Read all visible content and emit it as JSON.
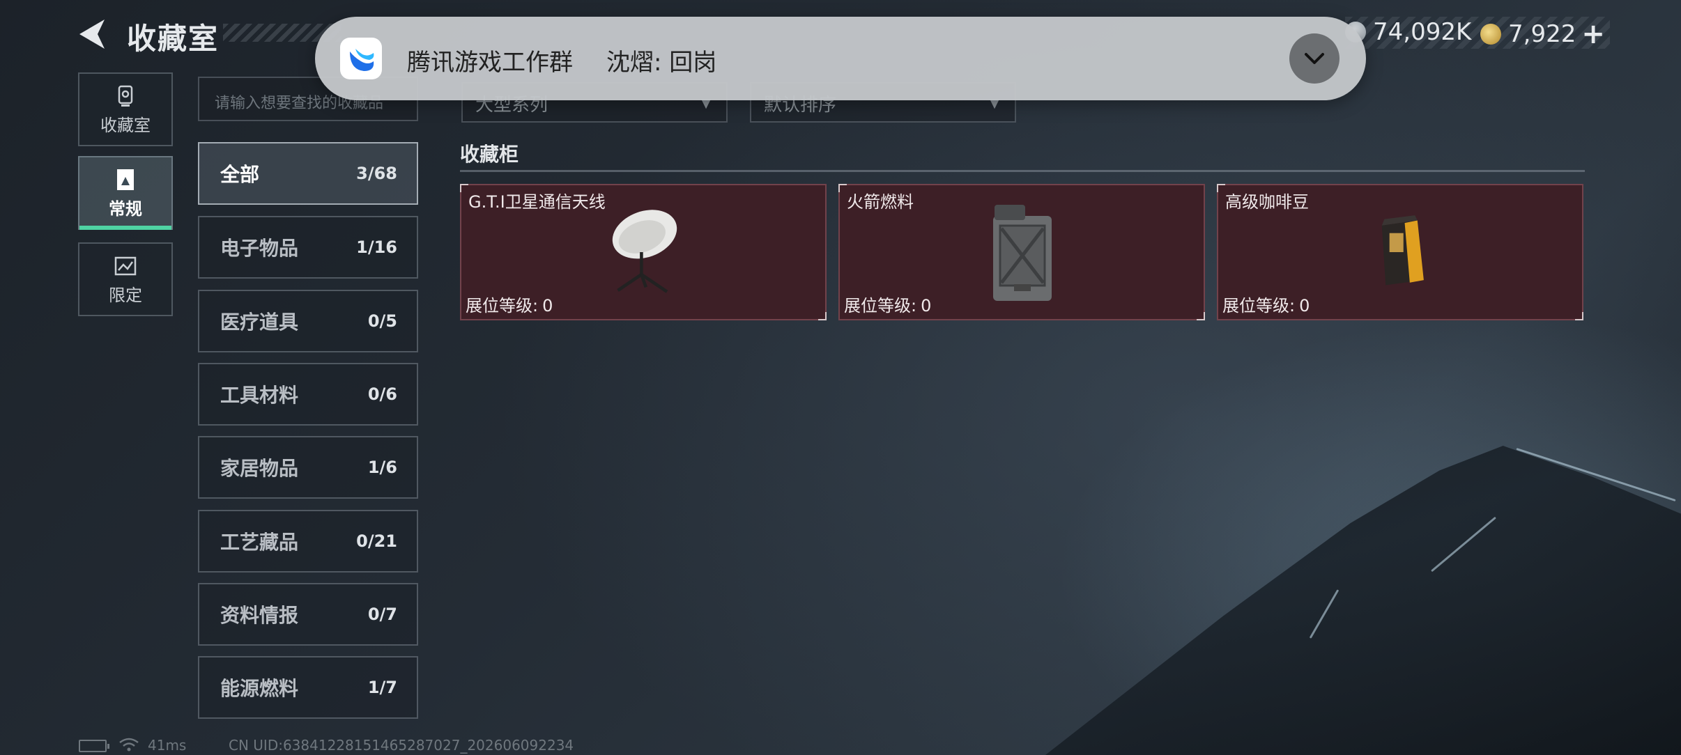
{
  "header": {
    "title": "收藏室",
    "currency_silver": "74,092K",
    "currency_gold": "7,922"
  },
  "nav": {
    "items": [
      {
        "label": "收藏室",
        "icon": "trophy-icon"
      },
      {
        "label": "常规",
        "icon": "card-icon",
        "active": true
      },
      {
        "label": "限定",
        "icon": "image-icon"
      }
    ]
  },
  "search": {
    "placeholder": "请输入想要查找的收藏品"
  },
  "filters": {
    "dropdown1": "大型系列",
    "dropdown2": "默认排序"
  },
  "categories": [
    {
      "name": "全部",
      "count": "3/68",
      "active": true
    },
    {
      "name": "电子物品",
      "count": "1/16"
    },
    {
      "name": "医疗道具",
      "count": "0/5"
    },
    {
      "name": "工具材料",
      "count": "0/6"
    },
    {
      "name": "家居物品",
      "count": "1/6"
    },
    {
      "name": "工艺藏品",
      "count": "0/21"
    },
    {
      "name": "资料情报",
      "count": "0/7"
    },
    {
      "name": "能源燃料",
      "count": "1/7"
    }
  ],
  "section": {
    "title": "收藏柜"
  },
  "items": [
    {
      "name": "G.T.I卫星通信天线",
      "level_label": "展位等级:",
      "level": "0",
      "icon": "satellite-dish-icon"
    },
    {
      "name": "火箭燃料",
      "level_label": "展位等级:",
      "level": "0",
      "icon": "fuel-can-icon"
    },
    {
      "name": "高级咖啡豆",
      "level_label": "展位等级:",
      "level": "0",
      "icon": "coffee-bag-icon"
    }
  ],
  "status_bar": {
    "latency": "41ms",
    "uid": "CN UID:63841228151465287027_202606092234"
  },
  "notification": {
    "app": "腾讯游戏工作群",
    "message": "沈熠: 回岗"
  },
  "colors": {
    "accent": "#4fd3a3",
    "card_bg": "#3d1f26",
    "background": "#1f262e"
  }
}
